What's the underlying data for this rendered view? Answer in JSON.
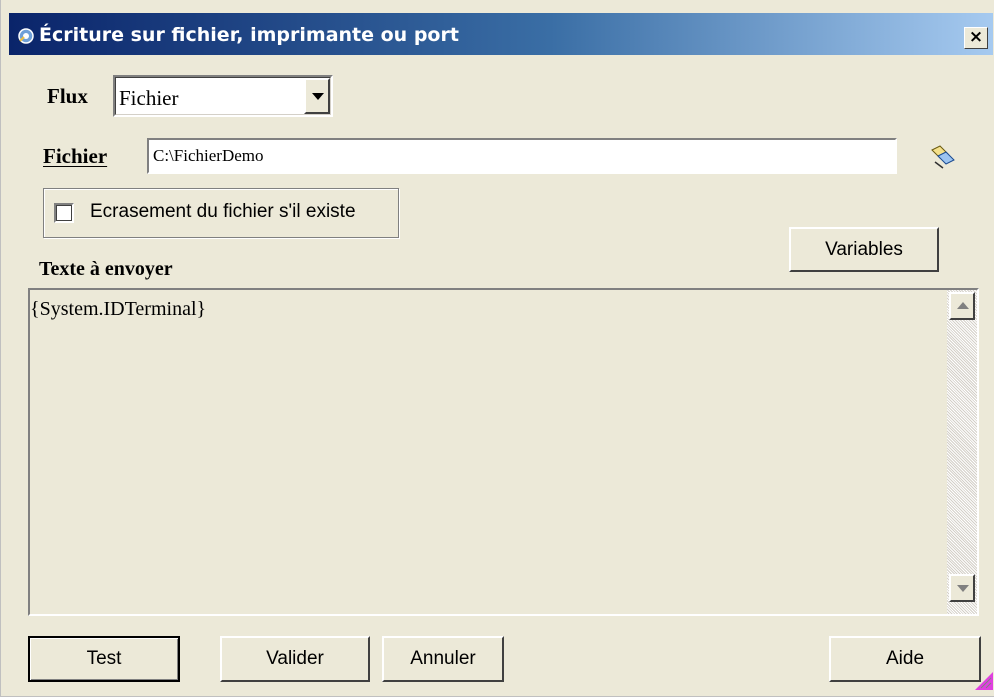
{
  "window": {
    "title": "Écriture sur fichier, imprimante ou port",
    "close_glyph": "×"
  },
  "flux": {
    "label": "Flux",
    "selected": "Fichier"
  },
  "fichier": {
    "label": "Fichier",
    "value": "C:\\FichierDemo"
  },
  "options": {
    "overwrite_label": "Ecrasement du fichier s'il existe",
    "overwrite_checked": false
  },
  "text_section": {
    "label": "Texte à envoyer",
    "content": "{System.IDTerminal}",
    "variables_button": "Variables"
  },
  "buttons": {
    "test": "Test",
    "valider": "Valider",
    "annuler": "Annuler",
    "aide": "Aide"
  },
  "icons": {
    "title": "app-gear-icon",
    "browse": "browse-file-icon",
    "resize": "resize-grip-icon"
  }
}
